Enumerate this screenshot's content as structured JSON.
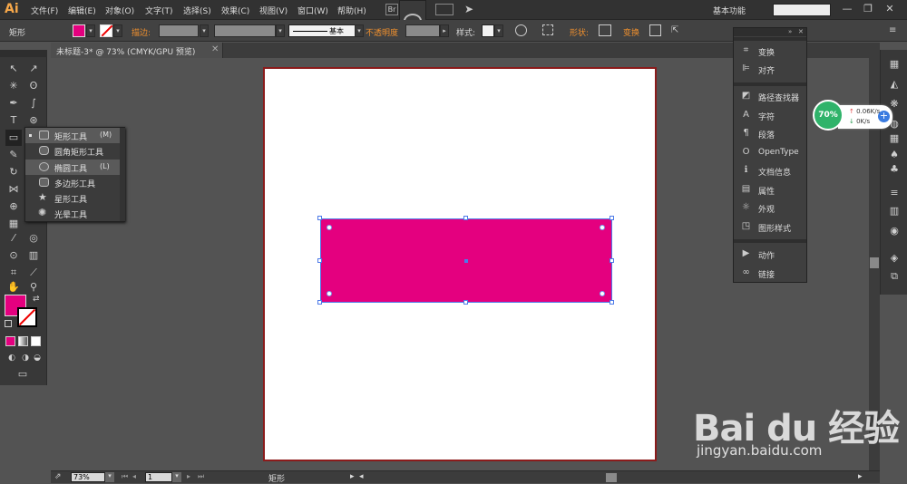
{
  "app": {
    "logo": "Ai"
  },
  "menubar": {
    "items": [
      "文件(F)",
      "编辑(E)",
      "对象(O)",
      "文字(T)",
      "选择(S)",
      "效果(C)",
      "视图(V)",
      "窗口(W)",
      "帮助(H)"
    ],
    "bridge_label": "Br",
    "workspace": "基本功能",
    "search_placeholder": ""
  },
  "control": {
    "tool_name": "矩形",
    "fill_color": "#e4007f",
    "stroke_label": "描边:",
    "stroke_profile": "基本",
    "opacity_label": "不透明度",
    "style_label": "样式:",
    "shape_label": "形状:",
    "transform_label": "变换"
  },
  "document": {
    "tab_title": "未标题-3* @ 73% (CMYK/GPU 预览)",
    "zoom": "73%",
    "page": "1",
    "status_tool": "矩形"
  },
  "flyout": {
    "items": [
      {
        "label": "矩形工具",
        "shortcut": "(M)",
        "icon": "rectangle-icon"
      },
      {
        "label": "圆角矩形工具",
        "shortcut": "",
        "icon": "rounded-rectangle-icon"
      },
      {
        "label": "椭圆工具",
        "shortcut": "(L)",
        "icon": "ellipse-icon"
      },
      {
        "label": "多边形工具",
        "shortcut": "",
        "icon": "polygon-icon"
      },
      {
        "label": "星形工具",
        "shortcut": "",
        "icon": "star-icon"
      },
      {
        "label": "光晕工具",
        "shortcut": "",
        "icon": "flare-icon"
      }
    ]
  },
  "panels": {
    "group1": [
      "变换",
      "对齐"
    ],
    "group2": [
      "路径查找器",
      "字符",
      "段落",
      "OpenType",
      "文档信息",
      "属性",
      "外观",
      "图形样式"
    ],
    "group3": [
      "动作",
      "链接"
    ]
  },
  "net_widget": {
    "percent": "70%",
    "up": "0.06K/s",
    "down": "0K/s"
  },
  "watermark": {
    "logo": "Bai du 经验",
    "url": "jingyan.baidu.com"
  },
  "colors": {
    "fill": "#e4007f",
    "artboard_border": "#8b1b1b",
    "selection": "#4d7ae8"
  }
}
